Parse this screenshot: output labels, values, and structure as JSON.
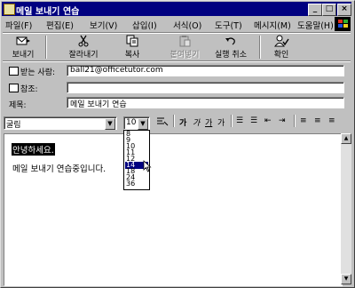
{
  "window": {
    "title": "메일 보내기 연습",
    "controls": {
      "minimize": "_",
      "maximize": "□",
      "close": "×"
    }
  },
  "menu": [
    "파일(F)",
    "편집(E)",
    "보기(V)",
    "삽입(I)",
    "서식(O)",
    "도구(T)",
    "메시지(M)",
    "도움말(H)"
  ],
  "toolbar": {
    "send": "보내기",
    "cut": "잘라내기",
    "copy": "복사",
    "paste": "붙여넣기",
    "undo": "실행 취소",
    "check": "확인"
  },
  "header": {
    "to_label": "받는 사람:",
    "to_value": "ball21@officetutor.com",
    "cc_label": "참조:",
    "cc_value": "",
    "subject_label": "제목:",
    "subject_value": "메일 보내기 연습"
  },
  "format": {
    "font": "굴림",
    "size": "10",
    "size_options": [
      "8",
      "9",
      "10",
      "11",
      "12",
      "14",
      "18",
      "24",
      "36"
    ],
    "size_highlighted": "14",
    "buttons": [
      "가",
      "가",
      "가",
      "가"
    ]
  },
  "body": {
    "line1": "안녕하세요.",
    "line2": "메일 보내기 연습중입니다."
  },
  "icons": {
    "send": "send-mail-icon",
    "cut": "scissors-icon",
    "copy": "copy-icon",
    "paste": "paste-icon",
    "undo": "undo-icon",
    "check": "check-names-icon",
    "windows": "windows-logo-icon"
  }
}
